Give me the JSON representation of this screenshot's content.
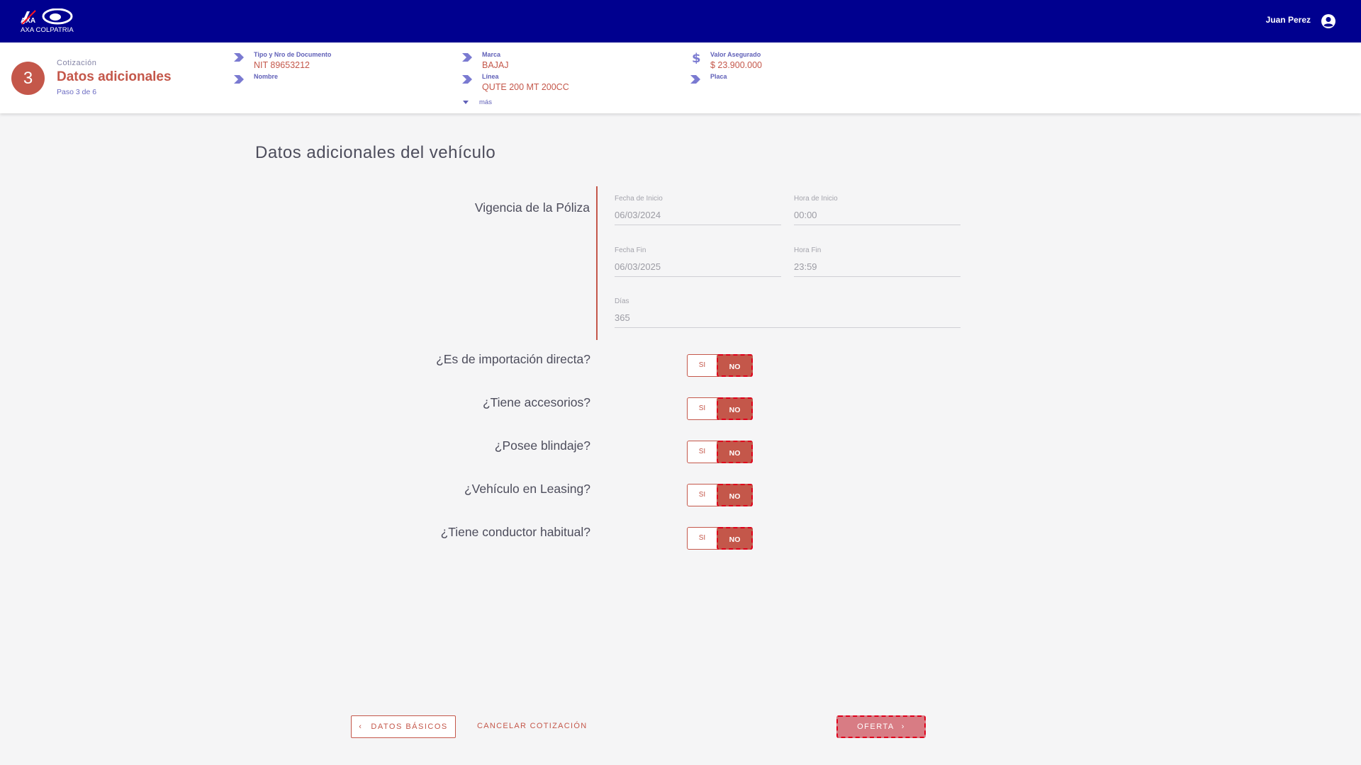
{
  "brand": {
    "logo_text": "AXA COLPATRIA",
    "primary_color": "#00008f",
    "accent_color": "#c4574a"
  },
  "user": {
    "name": "Juan Perez",
    "icon": "account-circle-icon"
  },
  "step": {
    "number": "3",
    "pre_title": "Cotización",
    "title": "Datos adicionales",
    "subtitle": "Paso 3 de 6"
  },
  "summary": {
    "document": {
      "label": "Tipo y Nro de Documento",
      "value": "NIT 89653212",
      "icon": "chevron-arrow-icon"
    },
    "name": {
      "label": "Nombre",
      "value": "",
      "icon": "chevron-arrow-icon"
    },
    "brand": {
      "label": "Marca",
      "value": "BAJAJ",
      "icon": "chevron-arrow-icon"
    },
    "line": {
      "label": "Línea",
      "value": "QUTE 200 MT 200CC",
      "icon": "chevron-arrow-icon"
    },
    "insured_value": {
      "label": "Valor Asegurado",
      "value": "$ 23.900.000",
      "icon": "dollar-icon"
    },
    "plate": {
      "label": "Placa",
      "value": "",
      "icon": "chevron-arrow-icon"
    },
    "more_label": "más"
  },
  "main": {
    "section_title": "Datos adicionales del vehículo",
    "policy": {
      "label": "Vigencia de la Póliza",
      "start_date": {
        "label": "Fecha de Inicio",
        "value": "06/03/2024"
      },
      "start_time": {
        "label": "Hora de Inicio",
        "value": "00:00"
      },
      "end_date": {
        "label": "Fecha Fin",
        "value": "06/03/2025"
      },
      "end_time": {
        "label": "Hora Fin",
        "value": "23:59"
      },
      "days": {
        "label": "Días",
        "value": "365"
      }
    },
    "questions": [
      {
        "label": "¿Es de importación directa?",
        "yes": "SI",
        "no": "NO",
        "selected": "NO"
      },
      {
        "label": "¿Tiene accesorios?",
        "yes": "SI",
        "no": "NO",
        "selected": "NO"
      },
      {
        "label": "¿Posee blindaje?",
        "yes": "SI",
        "no": "NO",
        "selected": "NO"
      },
      {
        "label": "¿Vehículo en Leasing?",
        "yes": "SI",
        "no": "NO",
        "selected": "NO"
      },
      {
        "label": "¿Tiene conductor habitual?",
        "yes": "SI",
        "no": "NO",
        "selected": "NO"
      }
    ]
  },
  "footer": {
    "back_label": "DATOS BÁSICOS",
    "cancel_label": "CANCELAR COTIZACIÓN",
    "next_label": "OFERTA"
  }
}
